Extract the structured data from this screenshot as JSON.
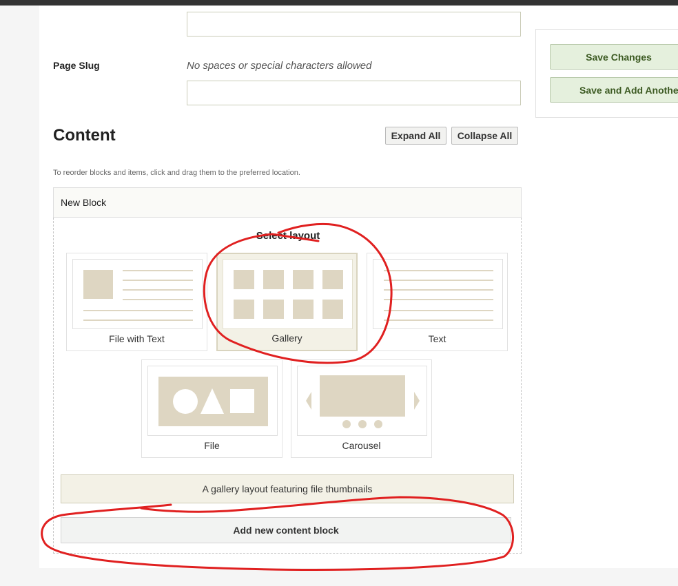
{
  "form": {
    "page_slug_label": "Page Slug",
    "page_slug_hint": "No spaces or special characters allowed",
    "title_value": "",
    "slug_value": ""
  },
  "content": {
    "title": "Content",
    "expand_all": "Expand All",
    "collapse_all": "Collapse All",
    "reorder_note": "To reorder blocks and items, click and drag them to the preferred location.",
    "block_title": "New Block",
    "select_layout": "Select layout",
    "layouts": [
      {
        "label": "File with Text",
        "icon": "file-with-text-layout-icon",
        "selected": false
      },
      {
        "label": "Gallery",
        "icon": "gallery-layout-icon",
        "selected": true
      },
      {
        "label": "Text",
        "icon": "text-layout-icon",
        "selected": false
      },
      {
        "label": "File",
        "icon": "file-layout-icon",
        "selected": false
      },
      {
        "label": "Carousel",
        "icon": "carousel-layout-icon",
        "selected": false
      }
    ],
    "layout_description": "A gallery layout featuring file thumbnails",
    "add_block": "Add new content block"
  },
  "sidebar": {
    "save_changes": "Save Changes",
    "save_and_add": "Save and Add Another Item"
  },
  "colors": {
    "accent_green_bg": "#e5f0dd",
    "accent_green_text": "#3c5a22",
    "layout_shape": "#ded6c2",
    "selected_bg": "#f3f1e6",
    "annotation_red": "#e02020"
  }
}
